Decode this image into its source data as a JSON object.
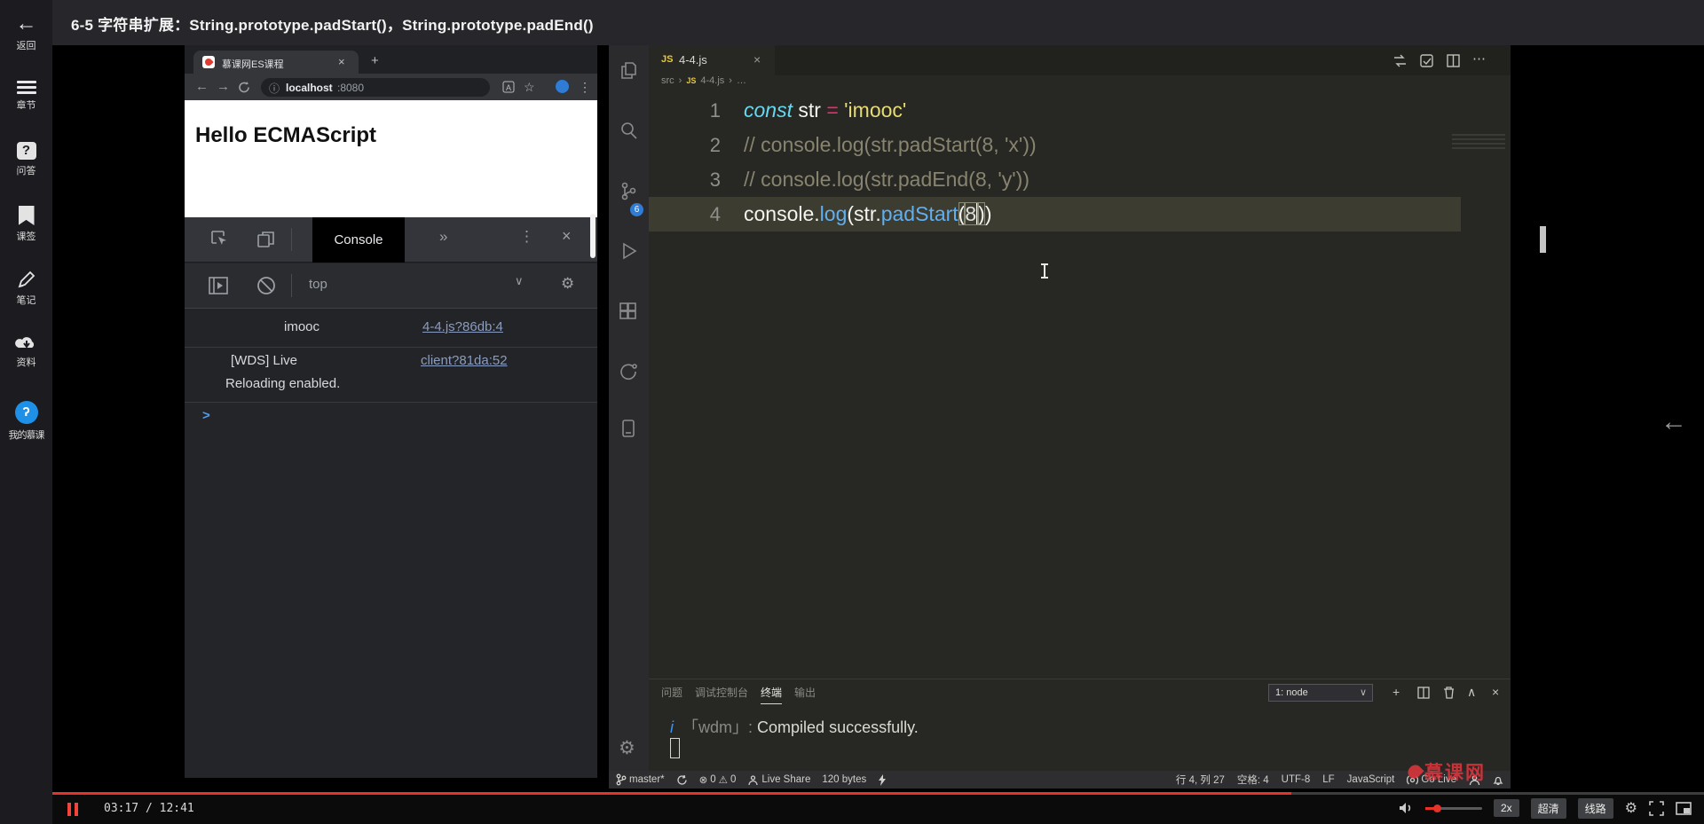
{
  "icons": {
    "close": "×",
    "add": "+",
    "more_tabs": "»",
    "kebab": "⋮",
    "back": "←",
    "star": "☆",
    "info": "ⓘ",
    "ellipsis": "⋯",
    "caret_down": "∨",
    "caret_up": "∧",
    "prompt": ">",
    "gear": "⚙",
    "collapse": "←",
    "error": "⊗",
    "warn": "⚠",
    "nav_back": "←",
    "nav_fwd": "→",
    "question": "?"
  },
  "player": {
    "title": "6-5 字符串扩展：String.prototype.padStart()，String.prototype.padEnd()",
    "sidebar": {
      "back": "返回",
      "items": [
        {
          "label": "章节"
        },
        {
          "label": "问答"
        },
        {
          "label": "课签"
        },
        {
          "label": "笔记"
        },
        {
          "label": "资料"
        },
        {
          "label": "我的慕课"
        }
      ]
    },
    "watermark": "慕课网",
    "controls": {
      "time": "03:17 / 12:41",
      "progress_pct": 75,
      "speed": "2x",
      "quality": "超清",
      "line": "线路"
    }
  },
  "browser": {
    "tab_title": "慕课网ES课程",
    "url_host": "localhost",
    "url_port": ":8080",
    "page_heading": "Hello ECMAScript",
    "devtools": {
      "tab": "Console",
      "context": "top",
      "log1": {
        "text": "imooc",
        "source": "4-4.js?86db:4"
      },
      "log2": {
        "line1": "[WDS] Live",
        "line2": "Reloading enabled.",
        "source": "client?81da:52"
      }
    }
  },
  "vscode": {
    "tab": {
      "lang": "JS",
      "name": "4-4.js"
    },
    "breadcrumb": {
      "root": "src",
      "sep": "›",
      "lang": "JS",
      "file": "4-4.js",
      "tail": "…"
    },
    "scm_badge": "6",
    "code": {
      "lines": [
        {
          "no": "1",
          "active": false,
          "tokens": [
            [
              "kw",
              "const"
            ],
            [
              "pl",
              " str "
            ],
            [
              "op",
              "="
            ],
            [
              "str",
              " 'imooc'"
            ]
          ]
        },
        {
          "no": "2",
          "active": false,
          "tokens": [
            [
              "com",
              "// console.log(str.padStart(8, 'x'))"
            ]
          ]
        },
        {
          "no": "3",
          "active": false,
          "tokens": [
            [
              "com",
              "// console.log(str.padEnd(8, 'y'))"
            ]
          ]
        },
        {
          "no": "4",
          "active": true,
          "tokens": [
            [
              "pl",
              "console."
            ],
            [
              "fn",
              "log"
            ],
            [
              "pl",
              "(str."
            ],
            [
              "fn",
              "padStart"
            ],
            [
              "brk",
              "("
            ],
            [
              "numc",
              "8"
            ],
            [
              "brk",
              ")"
            ],
            [
              "pl",
              ")"
            ]
          ]
        }
      ]
    },
    "panel": {
      "tabs": [
        "问题",
        "调试控制台",
        "终端",
        "输出"
      ],
      "active": "终端",
      "dropdown": "1: node",
      "term_info": "i",
      "term_bracket": "「wdm」:",
      "term_message": "Compiled successfully."
    },
    "status": {
      "branch": "master*",
      "errors": "0",
      "warnings": "0",
      "live_share": "Live Share",
      "bytes": "120 bytes",
      "line_col": "行 4, 列 27",
      "spaces": "空格: 4",
      "encoding": "UTF-8",
      "eol": "LF",
      "language": "JavaScript",
      "golive": "Go Live"
    }
  }
}
